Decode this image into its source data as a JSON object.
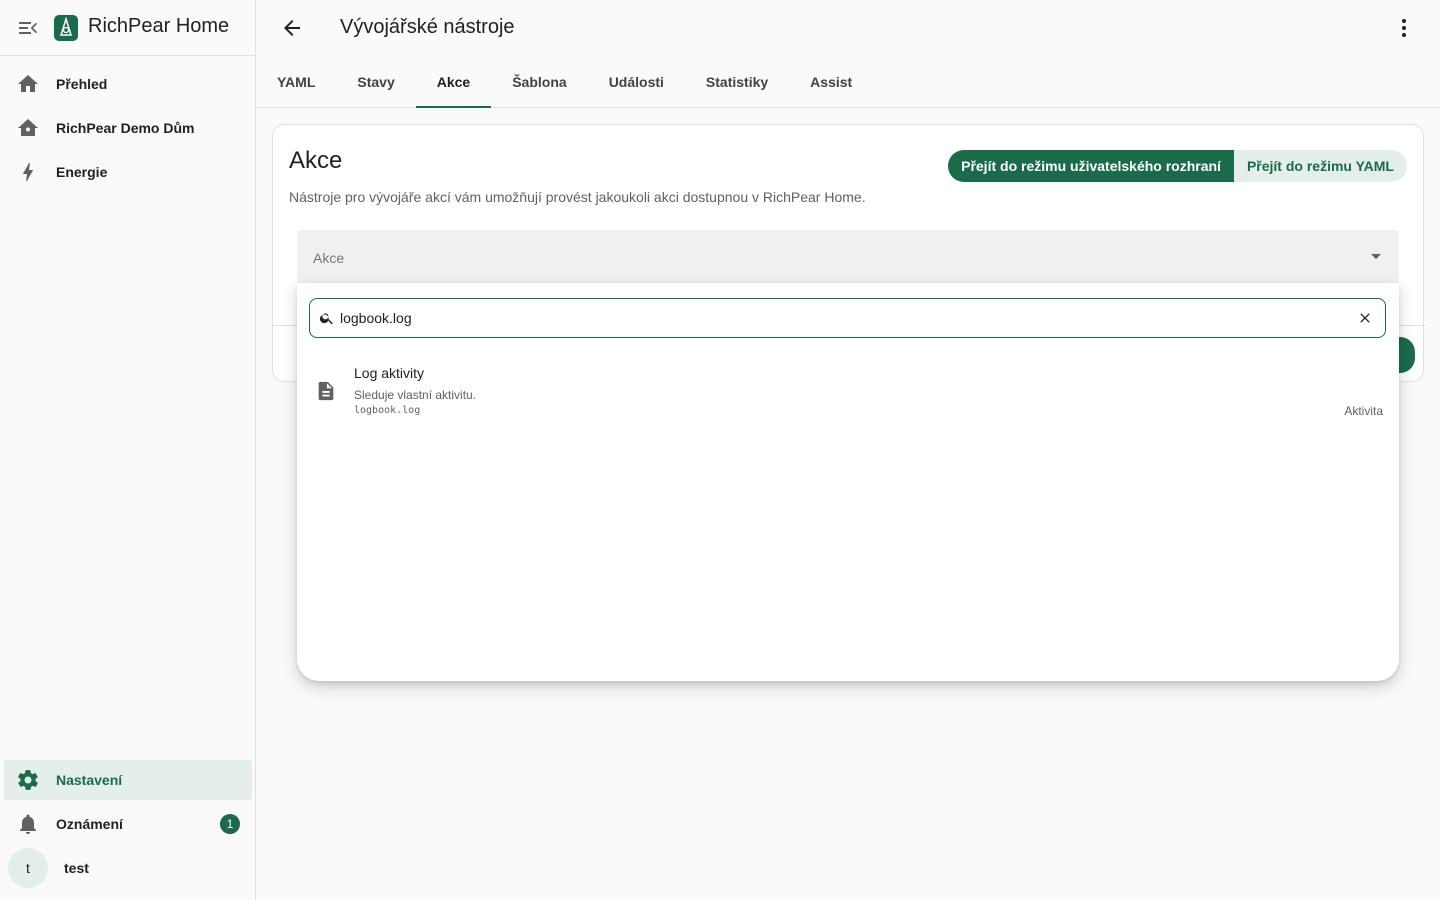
{
  "app": {
    "title": "RichPear Home"
  },
  "sidebar": {
    "items": [
      {
        "label": "Přehled",
        "icon": "home-icon"
      },
      {
        "label": "RichPear Demo Dům",
        "icon": "home-outline-icon"
      },
      {
        "label": "Energie",
        "icon": "lightning-icon"
      }
    ],
    "bottom": {
      "settings": "Nastavení",
      "notifications": "Oznámení",
      "notifications_count": "1",
      "user_initial": "t",
      "user_name": "test"
    }
  },
  "header": {
    "title": "Vývojářské nástroje",
    "tabs": [
      "YAML",
      "Stavy",
      "Akce",
      "Šablona",
      "Události",
      "Statistiky",
      "Assist"
    ],
    "active_tab": "Akce"
  },
  "card": {
    "title": "Akce",
    "description": "Nástroje pro vývojáře akcí vám umožňují provést jakoukoli akci dostupnou v RichPear Home.",
    "mode_ui": "Přejít do režimu uživatelského rozhraní",
    "mode_yaml": "Přejít do režimu YAML",
    "select_label": "Akce"
  },
  "dropdown": {
    "search_value": "logbook.log",
    "results": [
      {
        "title": "Log aktivity",
        "description": "Sleduje vlastní aktivitu.",
        "id": "logbook.log",
        "domain": "Aktivita"
      }
    ]
  },
  "colors": {
    "accent": "#1b6b4a",
    "accent_light": "#e3efe8"
  }
}
